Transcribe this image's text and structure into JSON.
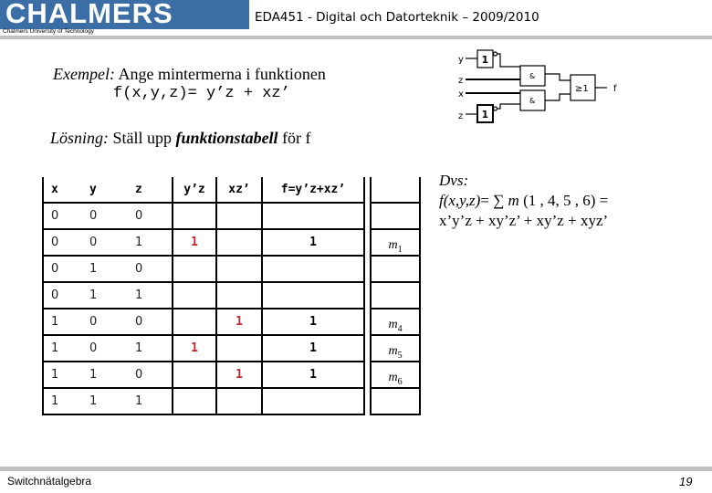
{
  "header": {
    "logo": "CHALMERS",
    "logo_subtitle": "Chalmers University of Technology",
    "title": "EDA451 - Digital och Datorteknik – 2009/2010"
  },
  "example": {
    "lead": "Exempel:",
    "text": " Ange mintermerna i funktionen",
    "formula": "f(x,y,z)= y’z + xz’"
  },
  "solution": {
    "lead": "Lösning:",
    "text": " Ställ upp ",
    "emphasis": "funktionstabell",
    "tail": " för f"
  },
  "circuit": {
    "inputs": [
      "y",
      "z",
      "x",
      "z"
    ],
    "not_gate_label": "1",
    "and_gate_label": "&",
    "or_gate_label": "≥1",
    "output": "f"
  },
  "truth_table": {
    "headers": [
      "x",
      "y",
      "z",
      "y’z",
      "xz’",
      "f=y’z+xz’"
    ],
    "rows": [
      {
        "x": "0",
        "y": "0",
        "z": "0",
        "yz": "",
        "xz": "",
        "f": "",
        "m": "",
        "m_sub": ""
      },
      {
        "x": "0",
        "y": "0",
        "z": "1",
        "yz": "1",
        "xz": "",
        "f": "1",
        "m": "m",
        "m_sub": "1"
      },
      {
        "x": "0",
        "y": "1",
        "z": "0",
        "yz": "",
        "xz": "",
        "f": "",
        "m": "",
        "m_sub": ""
      },
      {
        "x": "0",
        "y": "1",
        "z": "1",
        "yz": "",
        "xz": "",
        "f": "",
        "m": "",
        "m_sub": ""
      },
      {
        "x": "1",
        "y": "0",
        "z": "0",
        "yz": "",
        "xz": "1",
        "f": "1",
        "m": "m",
        "m_sub": "4"
      },
      {
        "x": "1",
        "y": "0",
        "z": "1",
        "yz": "1",
        "xz": "",
        "f": "1",
        "m": "m",
        "m_sub": "5"
      },
      {
        "x": "1",
        "y": "1",
        "z": "0",
        "yz": "",
        "xz": "1",
        "f": "1",
        "m": "m",
        "m_sub": "6"
      },
      {
        "x": "1",
        "y": "1",
        "z": "1",
        "yz": "",
        "xz": "",
        "f": "",
        "m": "",
        "m_sub": ""
      }
    ]
  },
  "conclusion": {
    "lead": "Dvs:",
    "line1_fn": "f(x,y,z)",
    "line1_rest": "= ∑ ",
    "line1_m": "m",
    "line1_tail": " (1 , 4, 5 , 6) =",
    "line2": "x’y’z + xy’z’ + xy’z + xyz’"
  },
  "colors": {
    "accent_red": "#c0262b",
    "logo_blue": "#3a6ea5",
    "band_gray": "#c0c0c0"
  },
  "footer": {
    "left": "Switchnätalgebra",
    "page_number": "19"
  }
}
